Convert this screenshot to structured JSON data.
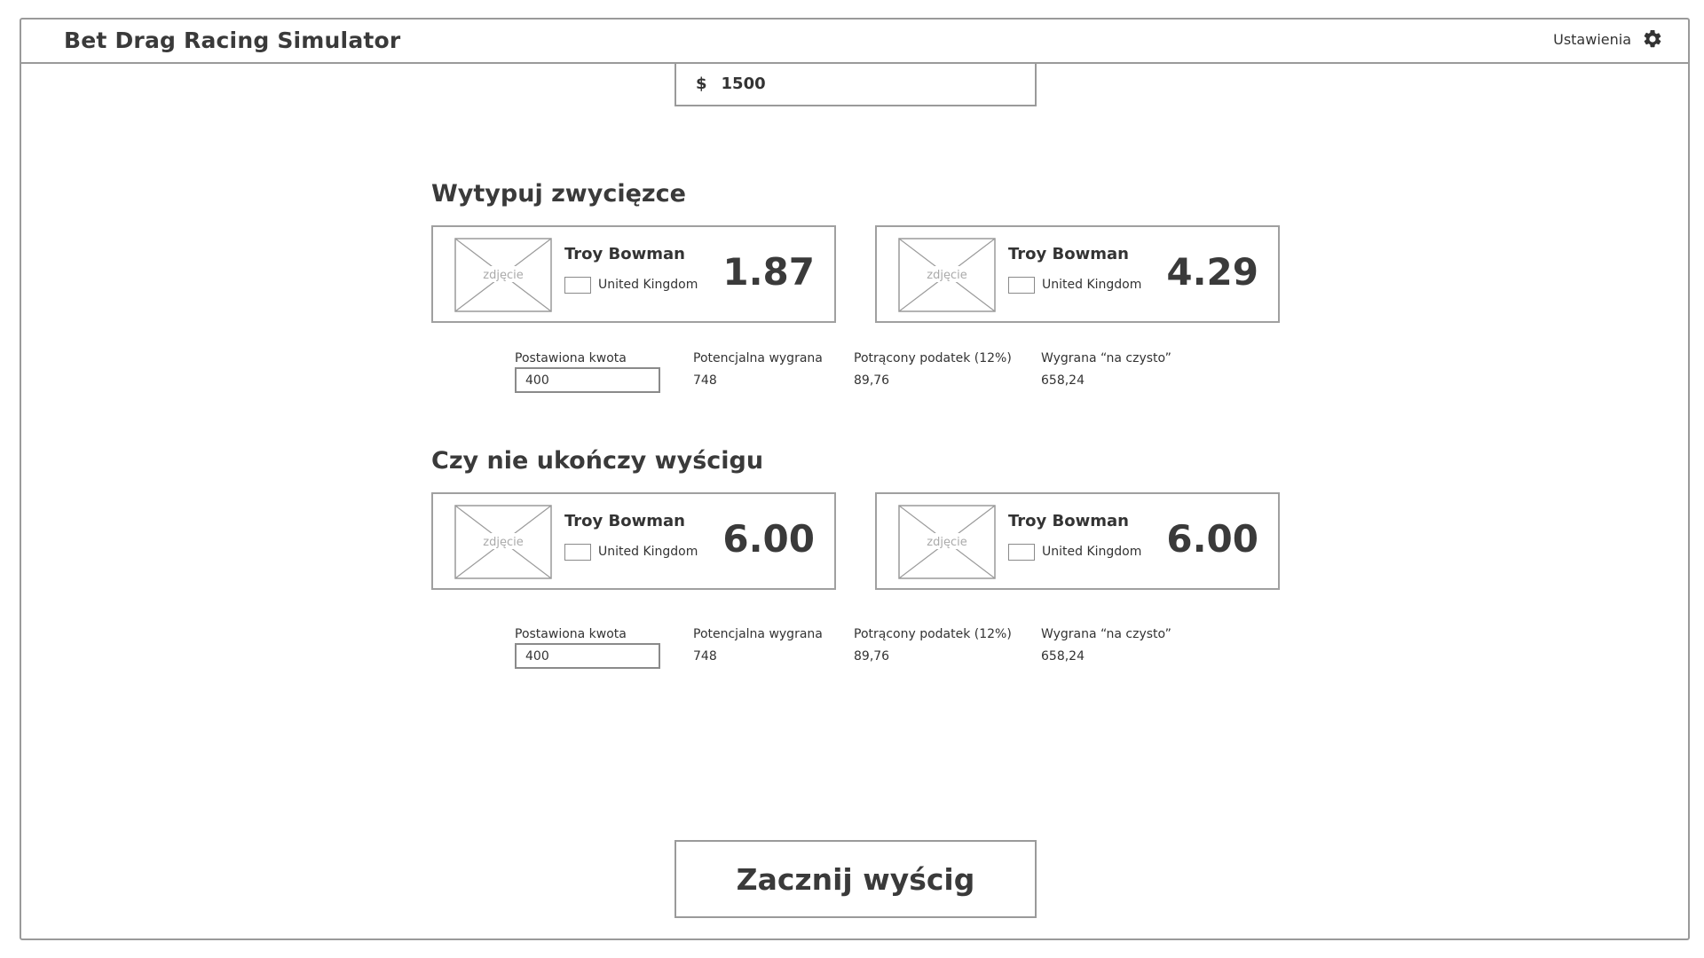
{
  "app": {
    "title": "Bet Drag Racing Simulator",
    "settings_label": "Ustawienia"
  },
  "balance": {
    "currency_symbol": "$",
    "amount": "1500"
  },
  "winner_section": {
    "title": "Wytypuj zwycięzce",
    "cards": [
      {
        "photo_label": "zdjęcie",
        "name": "Troy Bowman",
        "country": "United Kingdom",
        "odds": "1.87"
      },
      {
        "photo_label": "zdjęcie",
        "name": "Troy Bowman",
        "country": "United Kingdom",
        "odds": "4.29"
      }
    ],
    "bet": {
      "stake_label": "Postawiona kwota",
      "stake_value": "400",
      "potential_label": "Potencjalna wygrana",
      "potential_value": "748",
      "tax_label": "Potrącony podatek (12%)",
      "tax_value": "89,76",
      "net_label": "Wygrana “na czysto”",
      "net_value": "658,24"
    }
  },
  "dnf_section": {
    "title": "Czy nie ukończy wyścigu",
    "cards": [
      {
        "photo_label": "zdjęcie",
        "name": "Troy Bowman",
        "country": "United Kingdom",
        "odds": "6.00"
      },
      {
        "photo_label": "zdjęcie",
        "name": "Troy Bowman",
        "country": "United Kingdom",
        "odds": "6.00"
      }
    ],
    "bet": {
      "stake_label": "Postawiona kwota",
      "stake_value": "400",
      "potential_label": "Potencjalna wygrana",
      "potential_value": "748",
      "tax_label": "Potrącony podatek (12%)",
      "tax_value": "89,76",
      "net_label": "Wygrana “na czysto”",
      "net_value": "658,24"
    }
  },
  "start_button_label": "Zacznij wyścig",
  "icons": {
    "settings": "gear-icon",
    "photo": "image-placeholder-icon",
    "flag": "flag-placeholder-icon"
  }
}
